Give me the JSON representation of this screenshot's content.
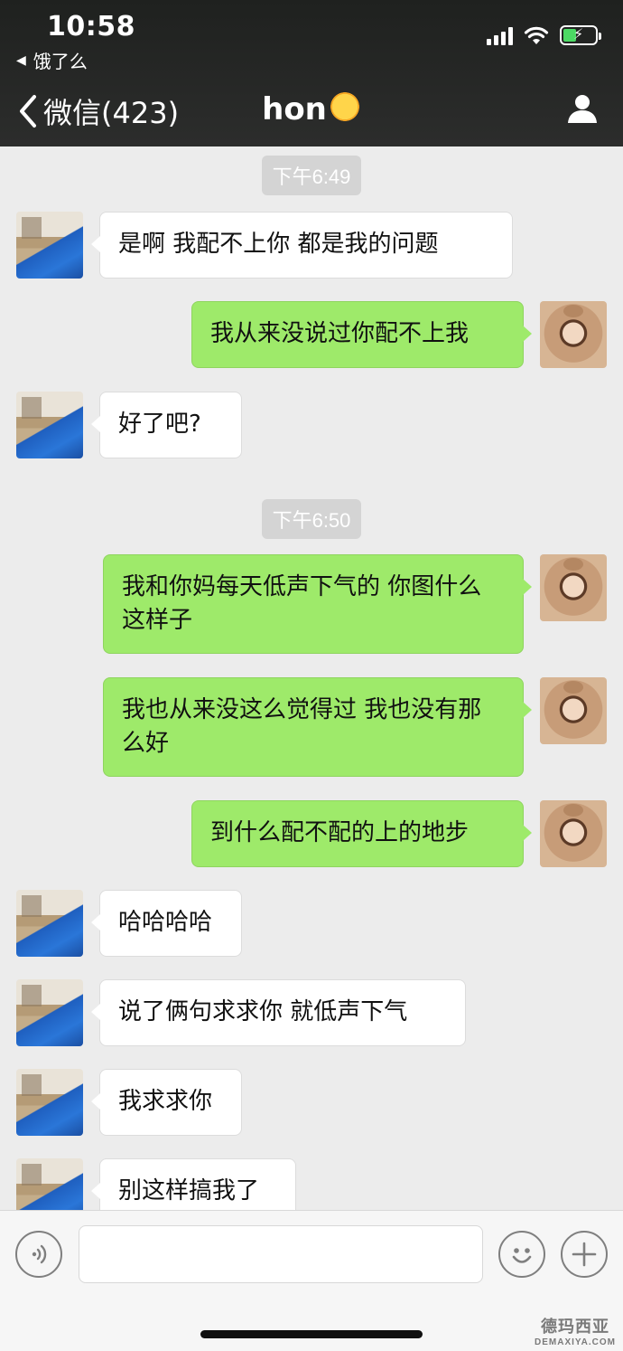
{
  "status_bar": {
    "time": "10:58",
    "back_app": "饿了么"
  },
  "nav": {
    "back_label": "微信(423)",
    "title": "hon"
  },
  "timestamps": [
    "下午6:49",
    "下午6:50"
  ],
  "messages": [
    {
      "side": "left",
      "text": "是啊 我配不上你  都是我的问题"
    },
    {
      "side": "right",
      "text": "我从来没说过你配不上我"
    },
    {
      "side": "left",
      "text": "好了吧?"
    },
    {
      "side": "right",
      "text": "我和你妈每天低声下气的 你图什么这样子"
    },
    {
      "side": "right",
      "text": "我也从来没这么觉得过 我也没有那么好"
    },
    {
      "side": "right",
      "text": "到什么配不配的上的地步"
    },
    {
      "side": "left",
      "text": "哈哈哈哈"
    },
    {
      "side": "left",
      "text": "说了俩句求求你 就低声下气"
    },
    {
      "side": "left",
      "text": "我求求你"
    },
    {
      "side": "left",
      "text": "别这样搞我了"
    }
  ],
  "watermark": {
    "line1": "德玛西亚",
    "line2": "DEMAXIYA.COM"
  },
  "colors": {
    "header_bg": "#2a2b2a",
    "chat_bg": "#ececec",
    "bubble_sent": "#9eea6a",
    "bubble_received": "#ffffff"
  },
  "icons": {
    "back": "chevron-left-icon",
    "user": "person-icon",
    "voice": "voice-icon",
    "emoji": "emoji-icon",
    "plus": "plus-icon"
  }
}
